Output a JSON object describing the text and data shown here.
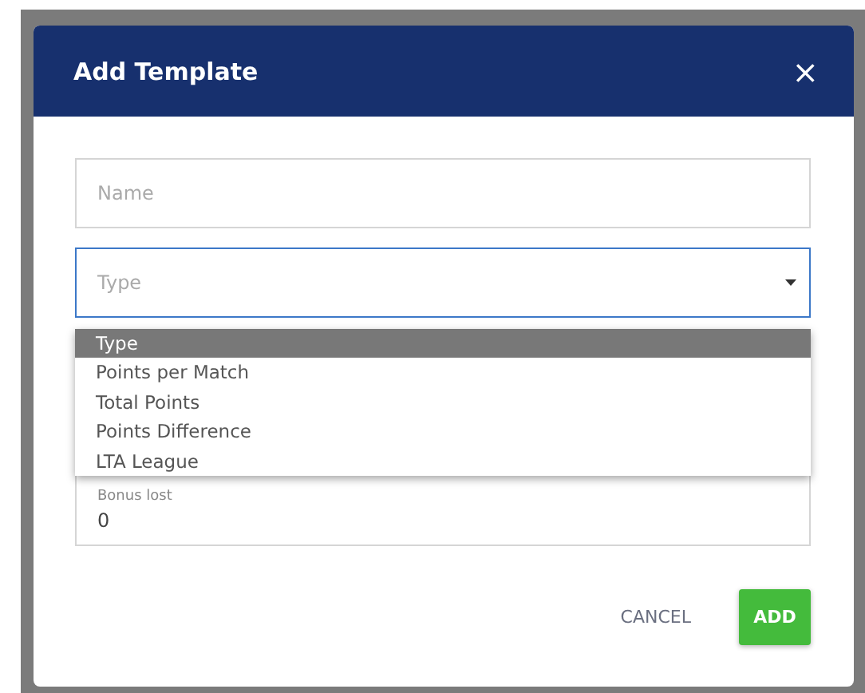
{
  "dialog": {
    "title": "Add Template",
    "close": "×"
  },
  "fields": [
    {
      "kind": "text",
      "placeholder": "Name"
    },
    {
      "kind": "select",
      "placeholder": "Type",
      "focused": true
    }
  ],
  "dropdown": [
    {
      "label": "Type",
      "selected": true
    },
    {
      "label": "Points per Match",
      "selected": false
    },
    {
      "label": "Total Points",
      "selected": false
    },
    {
      "label": "Points Difference",
      "selected": false
    },
    {
      "label": "LTA League",
      "selected": false
    }
  ],
  "bonus_field": {
    "label": "Bonus lost",
    "value": "0"
  },
  "buttons": [
    {
      "kind": "flat",
      "label": "CANCEL"
    },
    {
      "kind": "primary",
      "label": "ADD"
    }
  ]
}
